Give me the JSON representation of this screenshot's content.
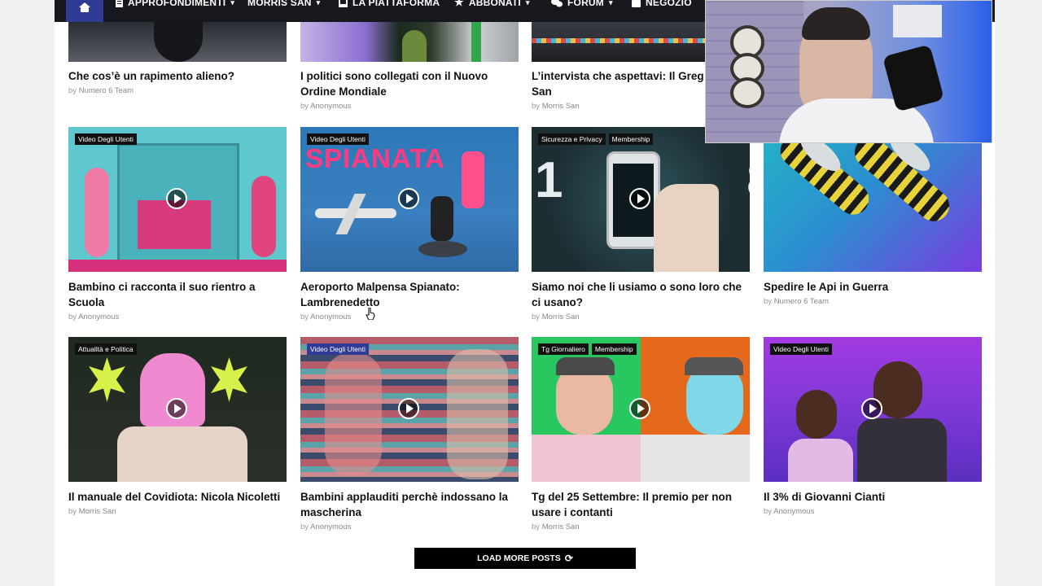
{
  "nav": {
    "items": [
      {
        "label": "APPROFONDIMENTI",
        "icon": "document-icon",
        "caret": true
      },
      {
        "label": "MORRIS SAN",
        "icon": "",
        "caret": true
      },
      {
        "label": "LA PIATTAFORMA",
        "icon": "book-icon",
        "caret": false
      },
      {
        "label": "ABBONATI",
        "icon": "star-icon",
        "caret": true
      },
      {
        "label": "FORUM",
        "icon": "chat-icon",
        "caret": true
      },
      {
        "label": "NEGOZIO",
        "icon": "bag-icon",
        "caret": false
      }
    ]
  },
  "by_prefix": "by",
  "top_row": [
    {
      "title": "Che cos’è un rapimento alieno?",
      "author": "Numero 6 Team"
    },
    {
      "title": "I politici sono collegati con il Nuovo Ordine Mondiale",
      "author": "Anonymous"
    },
    {
      "title": "L’intervista che aspettavi: Il Greg Morris San",
      "author": "Morris San"
    }
  ],
  "posts": [
    {
      "title": "Bambino ci racconta il suo rientro a Scuola",
      "author": "Anonymous",
      "badges": [
        "Video Degli Utenti"
      ],
      "play": true
    },
    {
      "title": "Aeroporto Malpensa Spianato: Lambrenedetto",
      "author": "Anonymous",
      "badges": [
        "Video Degli Utenti"
      ],
      "play": true,
      "overlay_text": "SPIANATA"
    },
    {
      "title": "Siamo noi che li usiamo o sono loro che ci usano?",
      "author": "Morris San",
      "badges": [
        "Sicurezza e Privacy",
        "Membership"
      ],
      "play": true,
      "overlay_text": "19 84"
    },
    {
      "title": "Spedire le Api in Guerra",
      "author": "Numero 6 Team",
      "badges": [],
      "play": false
    },
    {
      "title": "Il manuale del Covidiota: Nicola Nicoletti",
      "author": "Morris San",
      "badges": [
        "Attualità e Politica"
      ],
      "play": true
    },
    {
      "title": "Bambini applauditi perchè indossano la mascherina",
      "author": "Anonymous",
      "badges": [
        "Video Degli Utenti"
      ],
      "play": true
    },
    {
      "title": "Tg del 25 Settembre: Il premio per non usare i contanti",
      "author": "Morris San",
      "badges": [
        "Tg Giornaliero",
        "Membership"
      ],
      "play": true
    },
    {
      "title": "Il 3% di Giovanni Cianti",
      "author": "Anonymous",
      "badges": [
        "Video Degli Utenti"
      ],
      "play": true
    }
  ],
  "load_more": "LOAD MORE POSTS"
}
